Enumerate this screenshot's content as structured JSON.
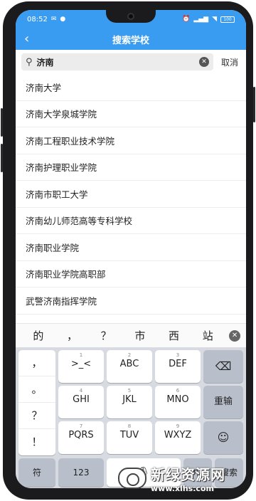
{
  "status_bar": {
    "time": "08:52",
    "battery": "100"
  },
  "header": {
    "title": "搜索学校",
    "back_icon": "chevron-left-icon"
  },
  "search": {
    "query": "济南",
    "cancel_label": "取消"
  },
  "results": [
    "济南大学",
    "济南大学泉城学院",
    "济南工程职业技术学院",
    "济南护理职业学院",
    "济南市职工大学",
    "济南幼儿师范高等专科学校",
    "济南职业学院",
    "济南职业学院高职部",
    "武警济南指挥学院"
  ],
  "candidates": [
    "的",
    "，",
    "？",
    "市",
    "西",
    "站"
  ],
  "keyboard": {
    "punct_keys": [
      "，",
      "。",
      "？",
      "！"
    ],
    "rows": [
      [
        {
          "num": "1",
          "label": ">_<"
        },
        {
          "num": "2",
          "label": "ABC"
        },
        {
          "num": "3",
          "label": "DEF"
        }
      ],
      [
        {
          "num": "4",
          "label": "GHI"
        },
        {
          "num": "5",
          "label": "JKL"
        },
        {
          "num": "6",
          "label": "MNO"
        }
      ],
      [
        {
          "num": "7",
          "label": "PQRS"
        },
        {
          "num": "8",
          "label": "TUV"
        },
        {
          "num": "9",
          "label": "WXYZ"
        }
      ]
    ],
    "reenter_label": "重输",
    "symbol_label": "符",
    "numeric_label": "123",
    "lang_label": "中",
    "search_label": "搜索"
  },
  "watermark": {
    "title": "新绿资源网",
    "url": "www.xlhs.com"
  }
}
